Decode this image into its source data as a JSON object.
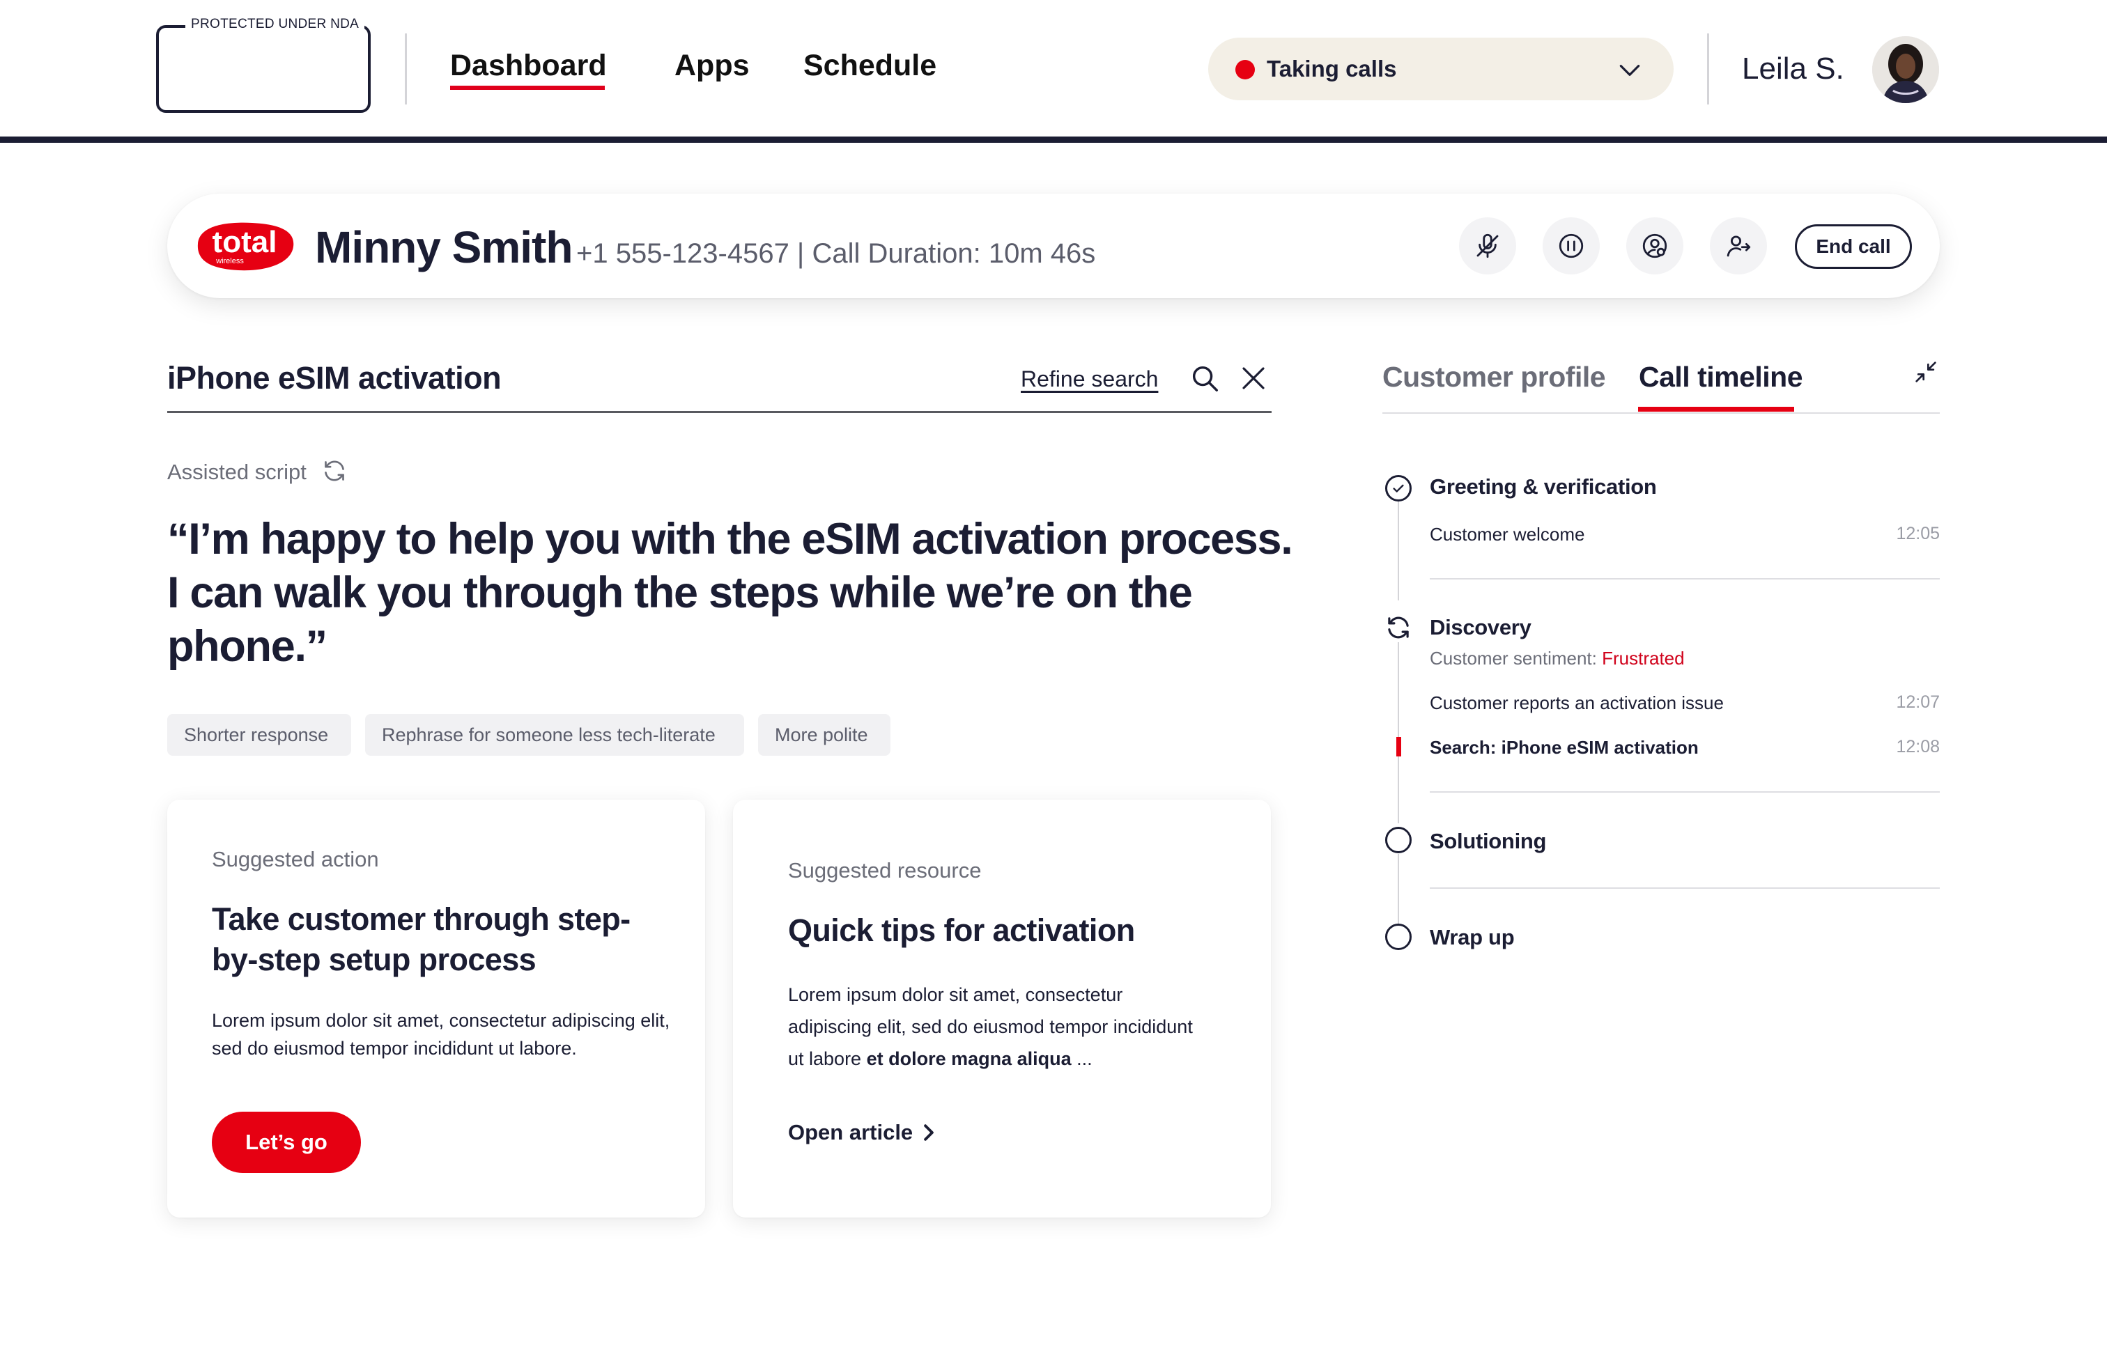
{
  "header": {
    "logo_label": "PROTECTED UNDER NDA",
    "nav": [
      {
        "label": "Dashboard",
        "active": true
      },
      {
        "label": "Apps",
        "active": false
      },
      {
        "label": "Schedule",
        "active": false
      }
    ],
    "status": {
      "label": "Taking calls",
      "color": "#e60012"
    },
    "user_name": "Leila S."
  },
  "call": {
    "brand": {
      "word": "total",
      "sub": "wireless",
      "color": "#e60012"
    },
    "customer_name": "Minny Smith",
    "meta": "+1 555-123-4567 | Call Duration: 10m 46s",
    "controls": [
      {
        "icon": "mute-microphone-icon"
      },
      {
        "icon": "pause-icon"
      },
      {
        "icon": "customer-account-icon"
      },
      {
        "icon": "transfer-user-icon"
      }
    ],
    "end_call_label": "End call"
  },
  "search": {
    "title": "iPhone eSIM activation",
    "refine_label": "Refine search"
  },
  "script": {
    "label": "Assisted script",
    "quote": "“I’m happy to help you with the eSIM activation process. I can walk you through the steps while we’re on the phone.”",
    "chips": [
      "Shorter response",
      "Rephrase for someone less tech-literate",
      "More polite"
    ]
  },
  "cards": {
    "action": {
      "eyebrow": "Suggested action",
      "title": "Take customer through step-by-step setup process",
      "body": "Lorem ipsum dolor sit amet, consectetur adipiscing elit, sed do eiusmod tempor incididunt ut labore.",
      "cta": "Let’s go"
    },
    "resource": {
      "eyebrow": "Suggested resource",
      "title": "Quick tips for activation",
      "body_regular": "Lorem ipsum dolor sit amet, consectetur adipiscing elit, sed do eiusmod tempor incididunt ut labore",
      "body_bold": "et dolore magna aliqua",
      "body_ellipsis": "...",
      "link": "Open article"
    }
  },
  "panel": {
    "tabs": [
      {
        "label": "Customer profile",
        "active": false
      },
      {
        "label": "Call timeline",
        "active": true
      }
    ],
    "timeline": {
      "greeting": {
        "title": "Greeting & verification",
        "state": "done",
        "items": [
          {
            "text": "Customer welcome",
            "time": "12:05"
          }
        ]
      },
      "discovery": {
        "title": "Discovery",
        "state": "in-progress",
        "sentiment_label": "Customer sentiment:",
        "sentiment_value": "Frustrated",
        "items": [
          {
            "text": "Customer reports an activation issue",
            "time": "12:07"
          },
          {
            "text": "Search: iPhone eSIM activation",
            "time": "12:08",
            "current": true
          }
        ]
      },
      "solutioning": {
        "title": "Solutioning",
        "state": "pending"
      },
      "wrapup": {
        "title": "Wrap up",
        "state": "pending"
      }
    }
  },
  "colors": {
    "accent": "#e60012",
    "ink": "#1b1d33",
    "muted": "#6b6d78",
    "pill": "#f3efe6"
  }
}
